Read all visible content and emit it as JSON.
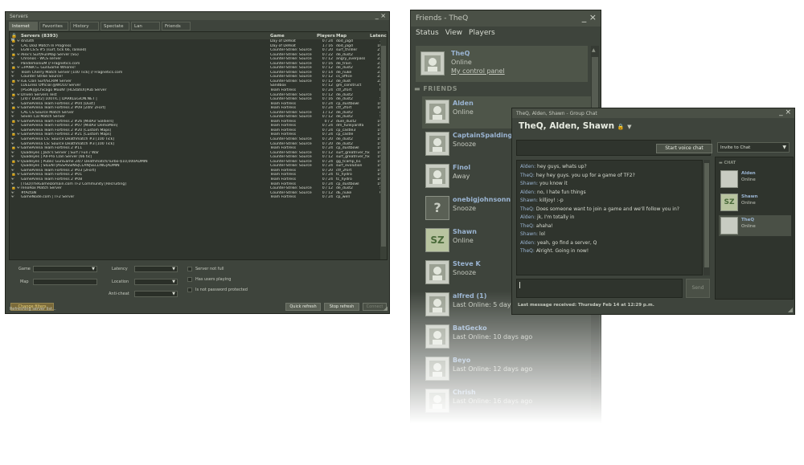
{
  "servers": {
    "title": "Servers",
    "tabs": [
      "Internet",
      "Favorites",
      "History",
      "Spectate",
      "Lan",
      "Friends"
    ],
    "columns": {
      "name": "Servers (8393)",
      "game": "Game",
      "players": "Players",
      "map": "Map",
      "latency": "Latency"
    },
    "rows": [
      [
        "4nd3th",
        "Day of Defeat",
        "0 / 24",
        "dod_jagd",
        "36"
      ],
      [
        "CAL DoD Match In Progress",
        "Day of Defeat",
        "1 / 16",
        "dod_jagd",
        "106"
      ],
      [
        "EGN CS:S #5 (surf, tick 66, ranked)",
        "Counter-Strike: Source",
        "0 / 20",
        "surf_thriller",
        "219"
      ],
      [
        "Alex's Surf/FunMap Server (SG)",
        "Counter-Strike: Source",
        "0 / 22",
        "de_dust2",
        "219"
      ],
      [
        "Chronos - WCS server",
        "Counter-Strike: Source",
        "0 / 12",
        "angry_overpass",
        "223"
      ],
      [
        "PandemoniuM // Fragnetics.com",
        "Counter-Strike: Source",
        "0 / 16",
        "de_train",
        "223"
      ],
      [
        "=PANiK!= GunGame Whores!",
        "Counter-Strike: Source",
        "0 / 12",
        "de_dust2",
        "227"
      ],
      [
        "Team Cherry Match Server [100 Tick] // Fragnetics.com",
        "Counter-Strike: Source",
        "0 / 14",
        "de_nuke",
        "227"
      ],
      [
        "Counter Strike Source!",
        "Counter-Strike: Source",
        "0 / 12",
        "cs_office",
        "227"
      ],
      [
        "iGE Clan Surf/SCRIM Server",
        "Counter-Strike: Source",
        "0 / 12",
        "de_dust",
        "223"
      ],
      [
        "LUELinks Official @WO10 Server",
        "Sandbox",
        "0 / 12",
        "gm_construct",
        "67"
      ],
      [
        "[PGoN]@Chicago MooN! [HLStatsX]Pub Server",
        "Team Fortress",
        "0 / 24",
        "ctf_2fort",
        "87"
      ],
      [
        "Driven Servers Test",
        "Counter-Strike: Source",
        "0 / 12",
        "de_dust2",
        "73"
      ],
      [
        "[24/7 Dust2] 100TIC | DARKLEGiON.NET |",
        "Counter-Strike: Source",
        "0 / 16",
        "de_dust2",
        "52"
      ],
      [
        "GameArena Team Fortress 2 #04 [Dust]",
        "Team Fortress",
        "0 / 24",
        "cp_dustbowl",
        "109"
      ],
      [
        "GameArena Team Fortress 2 #09 [24hr 2Fort]",
        "Team Fortress",
        "0 / 24",
        "ctf_2fort",
        "109"
      ],
      [
        "CAL CS:Source Match Server",
        "Counter-Strike: Source",
        "1 / 12",
        "de_dust2",
        "46"
      ],
      [
        "Seven Cal Match Server",
        "Counter-Strike: Source",
        "0 / 12",
        "de_dust2",
        "55"
      ],
      [
        "GameArena Team Fortress 2 #26 [MidAir Soldiers]",
        "Team Fortress",
        "0 / 2",
        "duel_dust2",
        "192"
      ],
      [
        "GameArena Team Fortress 2 #07 [MidAir DemoMen]",
        "Team Fortress",
        "0 / 24",
        "dm_funkyardfa",
        "192"
      ],
      [
        "GameArena Team Fortress 2 #20 [Custom Maps]",
        "Team Fortress",
        "0 / 24",
        "cp_castle3",
        "192"
      ],
      [
        "GameArena Team Fortress 2 #21 [Custom Maps]",
        "Team Fortress",
        "0 / 24",
        "cp_castle",
        "192"
      ],
      [
        "GameArena CS: Source Deathmatch #3 [100 Tick]",
        "Counter-Strike: Source",
        "0 / 20",
        "de_dust2",
        "194"
      ],
      [
        "GameArena CS: Source Deathmatch #3 [100 Tick]",
        "Counter-Strike: Source",
        "0 / 20",
        "de_dust2",
        "194"
      ],
      [
        "GameArena Team Fortress 2 #11",
        "Team Fortress",
        "0 / 24",
        "cp_dustbowl",
        "194"
      ],
      [
        "Quadeyes | Jack's Server | Surf / Fun / War",
        "Counter-Strike: Source",
        "0 / 12",
        "surf_greatriver_fix",
        "197"
      ],
      [
        "Quadeyes | All-Pro Clan Server [66 tic]",
        "Counter-Strike: Source",
        "0 / 12",
        "surf_greatriver_fix",
        "197"
      ],
      [
        "Quadeyes | Public GunGame 24/7 Deathmatch/Turbo-$10,000ADMIN",
        "Counter-Strike: Source",
        "0 / 24",
        "gg_tcamp_b1",
        "199"
      ],
      [
        "Quadeyes | SILENT|ASSASSINS|CLAN|SELLING|ADMIN",
        "Counter-Strike: Source",
        "0 / 24",
        "surf_evolution",
        "199"
      ],
      [
        "GameArena Team Fortress 2 #03 [2Fort]",
        "Team Fortress",
        "0 / 20",
        "ctf_2fort",
        "199"
      ],
      [
        "GameArena Team Fortress 2 #01",
        "Team Fortress",
        "0 / 24",
        "tc_hydro",
        "199"
      ],
      [
        "GameArena Team Fortress 2 #08",
        "Team Fortress",
        "0 / 24",
        "tc_hydro",
        "199"
      ],
      [
        "[TGD]TheGameDomain.com TF2 Community [Recruiting]",
        "Team Fortress",
        "0 / 24",
        "cp_dustbowl",
        "197"
      ],
      [
        "renoRox Match Server",
        "Counter-Strike: Source",
        "0 / 12",
        "de_dust2",
        "52"
      ],
      [
        "#fActaN",
        "Counter-Strike: Source",
        "0 / 12",
        "dE_nuke",
        "61"
      ],
      [
        "GameNode.com | TF2 Server",
        "Team Fortress",
        "0 / 24",
        "cp_well",
        "75"
      ]
    ],
    "filters": {
      "game_label": "Game",
      "map_label": "Map",
      "latency_label": "Latency",
      "location_label": "Location",
      "anticheat_label": "Anti-cheat",
      "not_full": "Server not full",
      "has_users": "Has users playing",
      "no_password": "Is not password protected"
    },
    "buttons": {
      "change_filters": "Change filters",
      "quick_refresh": "Quick refresh",
      "stop_refresh": "Stop refresh",
      "connect": "Connect"
    },
    "status": "Refreshing server list..."
  },
  "friends": {
    "title": "Friends - TheQ",
    "menu": [
      "Status",
      "View",
      "Players"
    ],
    "self": {
      "name": "TheQ",
      "status": "Online",
      "link": "My control panel"
    },
    "section": "FRIENDS",
    "list": [
      {
        "name": "Alden",
        "status": "Online",
        "avatar": "face-icon"
      },
      {
        "name": "CaptainSpalding",
        "status": "Snooze",
        "avatar": "face-icon"
      },
      {
        "name": "Finol",
        "status": "Away",
        "avatar": "face-icon"
      },
      {
        "name": "onebigjohnsonn",
        "status": "Snooze",
        "avatar": "question-icon"
      },
      {
        "name": "Shawn",
        "status": "Online",
        "avatar": "SZ"
      },
      {
        "name": "Steve K",
        "status": "Snooze",
        "avatar": "face-icon"
      },
      {
        "name": "alfred (1)",
        "status": "Last Online: 5 days",
        "avatar": "face-icon"
      },
      {
        "name": "BatGecko",
        "status": "Last Online: 10 days ago",
        "avatar": "face-icon"
      },
      {
        "name": "Beyo",
        "status": "Last Online: 12 days ago",
        "avatar": "face-icon"
      },
      {
        "name": "Chrish",
        "status": "Last Online: 16 days ago",
        "avatar": "face-icon"
      }
    ]
  },
  "chat": {
    "title": "TheQ, Alden, Shawn - Group Chat",
    "heading": "TheQ, Alden, Shawn",
    "voice_button": "Start voice chat",
    "invite": "Invite to Chat",
    "messages": [
      {
        "who": "Alden:",
        "text": "hey guys, whats up?"
      },
      {
        "who": "TheQ:",
        "text": "hey hey guys. you up for a game of TF2?"
      },
      {
        "who": "Shawn:",
        "text": "you know it"
      },
      {
        "who": "Alden:",
        "text": "no, I hate fun things"
      },
      {
        "who": "Shawn:",
        "text": "killjoy! :-p"
      },
      {
        "who": "TheQ:",
        "text": "Does someone want to join a game and we'll follow you in?"
      },
      {
        "who": "Alden:",
        "text": "jk, I'm totally in"
      },
      {
        "who": "TheQ:",
        "text": "ahaha!"
      },
      {
        "who": "Shawn:",
        "text": "lol"
      },
      {
        "who": "Alden:",
        "text": "yeah, go find a server, Q"
      },
      {
        "who": "TheQ:",
        "text": "Alright. Going in now!"
      }
    ],
    "send": "Send",
    "last_message": "Last message received: Thursday Feb 14 at 12:29 p.m.",
    "members_label": "CHAT",
    "members": [
      {
        "name": "Alden",
        "status": "Online"
      },
      {
        "name": "Shawn",
        "status": "Online"
      },
      {
        "name": "TheQ",
        "status": "Online"
      }
    ]
  }
}
